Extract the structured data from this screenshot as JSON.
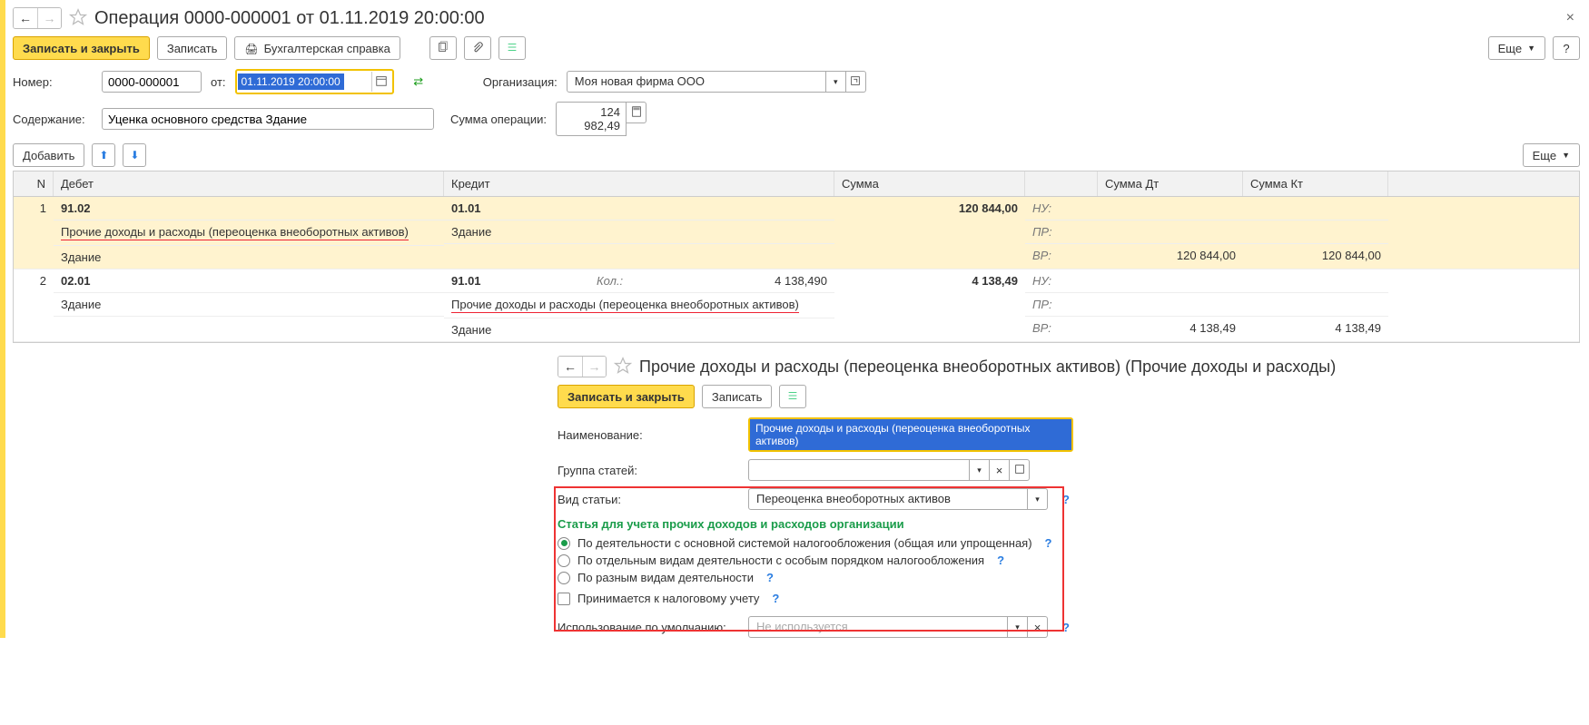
{
  "header": {
    "title": "Операция 0000-000001 от 01.11.2019 20:00:00"
  },
  "toolbar": {
    "save_close": "Записать и закрыть",
    "save": "Записать",
    "print_ref": "Бухгалтерская справка",
    "more": "Еще",
    "help": "?"
  },
  "form": {
    "number_label": "Номер:",
    "number_value": "0000-000001",
    "from_label": "от:",
    "date_value": "01.11.2019 20:00:00",
    "org_label": "Организация:",
    "org_value": "Моя новая фирма ООО",
    "content_label": "Содержание:",
    "content_value": "Уценка основного средства Здание",
    "sum_label": "Сумма операции:",
    "sum_value": "124 982,49"
  },
  "table_toolbar": {
    "add": "Добавить",
    "more": "Еще"
  },
  "table": {
    "cols": {
      "n": "N",
      "debit": "Дебет",
      "credit": "Кредит",
      "sum": "Сумма",
      "sum_dt": "Сумма Дт",
      "sum_kt": "Сумма Кт"
    },
    "rows": [
      {
        "n": "1",
        "d_acc": "91.02",
        "d_sub1": "Прочие доходы и расходы (переоценка внеоборотных активов)",
        "d_sub2": "Здание",
        "c_acc": "01.01",
        "c_sub1": "Здание",
        "sum": "120 844,00",
        "nu": "НУ:",
        "pr": "ПР:",
        "vr": "ВР:",
        "sum_dt": "120 844,00",
        "sum_kt": "120 844,00",
        "selected": true
      },
      {
        "n": "2",
        "d_acc": "02.01",
        "d_sub1": "Здание",
        "c_acc": "91.01",
        "c_qty_lbl": "Кол.:",
        "c_qty_val": "4 138,490",
        "c_sub1": "Прочие доходы и расходы (переоценка внеоборотных активов)",
        "c_sub2": "Здание",
        "sum": "4 138,49",
        "nu": "НУ:",
        "pr": "ПР:",
        "vr": "ВР:",
        "sum_dt": "4 138,49",
        "sum_kt": "4 138,49"
      }
    ]
  },
  "dialog": {
    "title": "Прочие доходы и расходы (переоценка внеоборотных активов) (Прочие доходы и расходы)",
    "save_close": "Записать и закрыть",
    "save": "Записать",
    "name_label": "Наименование:",
    "name_value": "Прочие доходы и расходы (переоценка внеоборотных активов)",
    "group_label": "Группа статей:",
    "group_value": "",
    "kind_label": "Вид статьи:",
    "kind_value": "Переоценка внеоборотных активов",
    "section_title": "Статья для учета прочих доходов и расходов организации",
    "radio1": "По деятельности с основной системой налогообложения (общая или упрощенная)",
    "radio2": "По отдельным видам деятельности с особым порядком налогообложения",
    "radio3": "По разным видам деятельности",
    "check1": "Принимается к налоговому учету",
    "default_label": "Использование по умолчанию:",
    "default_value": "Не используется"
  }
}
